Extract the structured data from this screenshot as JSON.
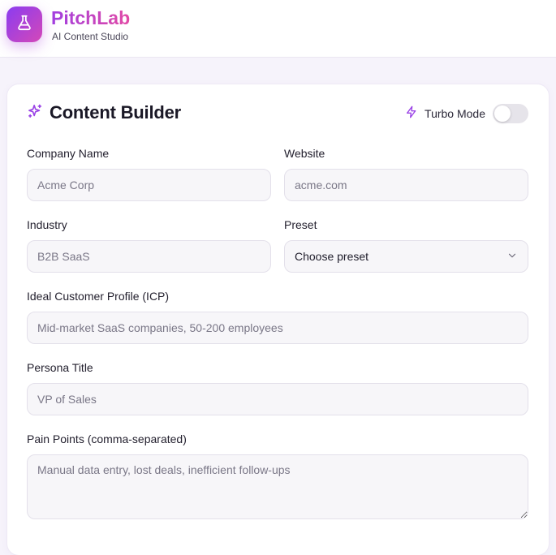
{
  "brand": {
    "name": "PitchLab",
    "subtitle": "AI Content Studio",
    "icon": "flask-icon",
    "gradient": [
      "#8b3cf0",
      "#d448b8"
    ]
  },
  "builder": {
    "title": "Content Builder",
    "title_icon": "sparkles-icon",
    "turbo": {
      "label": "Turbo Mode",
      "icon": "lightning-icon",
      "enabled": false
    }
  },
  "form": {
    "company_name": {
      "label": "Company Name",
      "placeholder": "Acme Corp",
      "value": ""
    },
    "website": {
      "label": "Website",
      "placeholder": "acme.com",
      "value": ""
    },
    "industry": {
      "label": "Industry",
      "placeholder": "B2B SaaS",
      "value": ""
    },
    "preset": {
      "label": "Preset",
      "selected": "Choose preset",
      "icon": "chevron-down-icon"
    },
    "icp": {
      "label": "Ideal Customer Profile (ICP)",
      "placeholder": "Mid-market SaaS companies, 50-200 employees",
      "value": ""
    },
    "persona_title": {
      "label": "Persona Title",
      "placeholder": "VP of Sales",
      "value": ""
    },
    "pain_points": {
      "label": "Pain Points (comma-separated)",
      "placeholder": "Manual data entry, lost deals, inefficient follow-ups",
      "value": ""
    }
  },
  "colors": {
    "accent": "#9b44e6",
    "brand_pink": "#e24aa6",
    "input_bg": "#f7f6f9",
    "input_border": "#e3e0ea"
  }
}
